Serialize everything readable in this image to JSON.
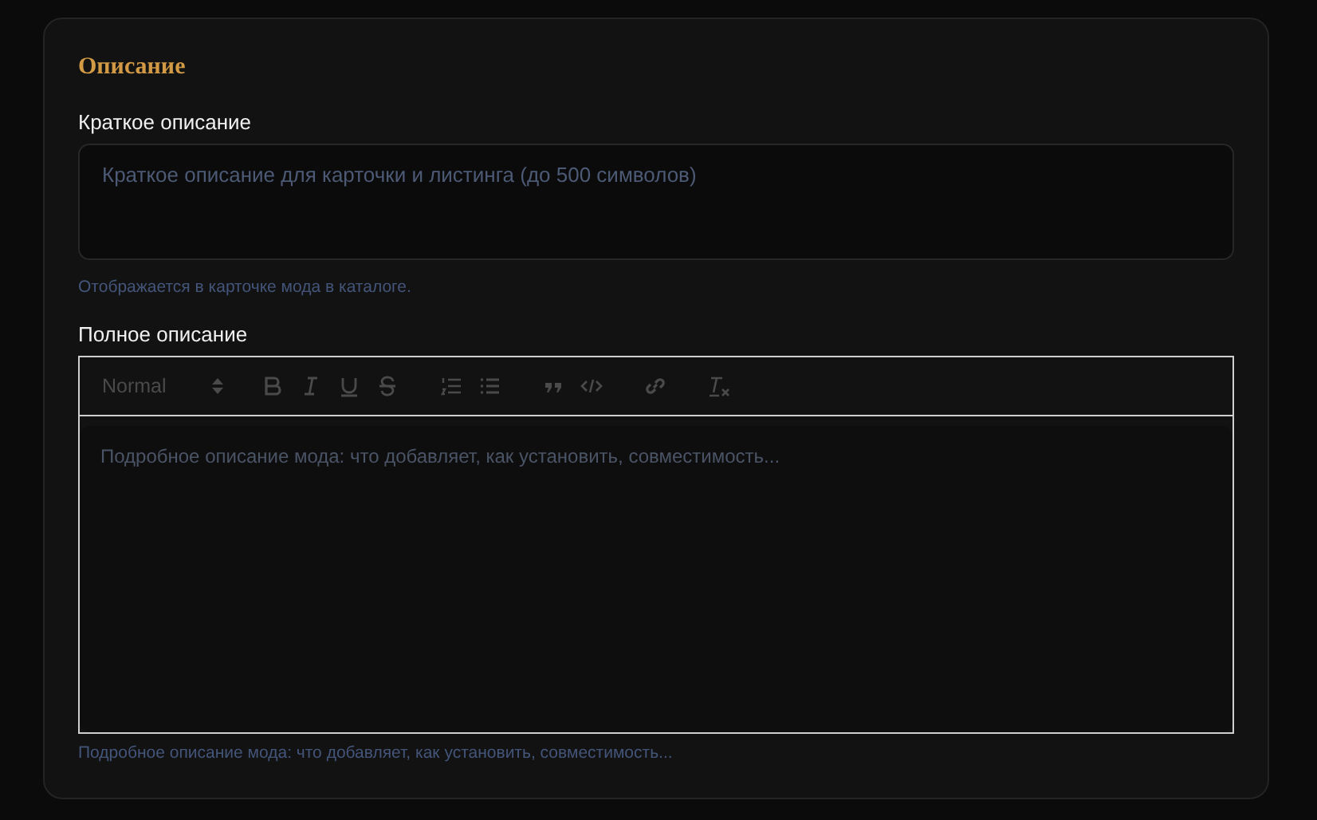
{
  "section": {
    "title": "Описание"
  },
  "short_description": {
    "label": "Краткое описание",
    "placeholder": "Краткое описание для карточки и листинга (до 500 символов)",
    "hint": "Отображается в карточке мода в каталоге."
  },
  "full_description": {
    "label": "Полное описание",
    "toolbar": {
      "format": "Normal",
      "groups": [
        [
          {
            "kind": "bold"
          },
          {
            "kind": "italic"
          },
          {
            "kind": "underline"
          },
          {
            "kind": "strike"
          }
        ],
        [
          {
            "kind": "ordered-list"
          },
          {
            "kind": "bullet-list"
          }
        ],
        [
          {
            "kind": "quote"
          },
          {
            "kind": "code"
          }
        ],
        [
          {
            "kind": "link"
          }
        ],
        [
          {
            "kind": "clear"
          }
        ]
      ]
    },
    "placeholder": "Подробное описание мода: что добавляет, как установить, совместимость...",
    "hint": "Подробное описание мода: что добавляет, как установить, совместимость..."
  }
}
